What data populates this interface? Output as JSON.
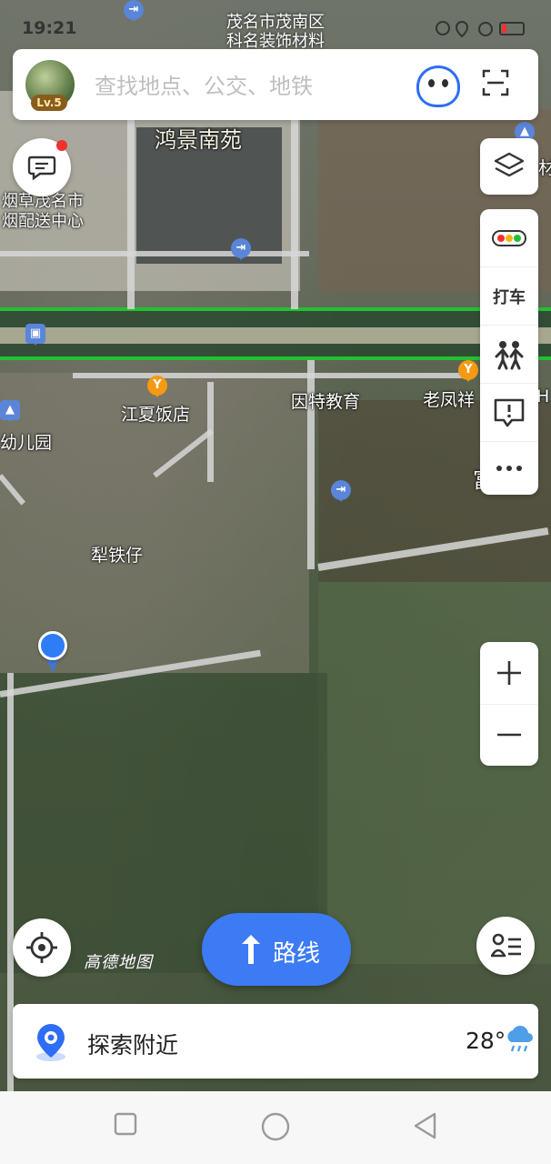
{
  "status_bar": {
    "time": "19:21",
    "top_location_line1": "茂名市茂南区",
    "top_location_line2": "科名装饰材料"
  },
  "search": {
    "level_badge": "Lv.5",
    "placeholder": "查找地点、公交、地铁"
  },
  "map_labels": {
    "hongjing": "鸿景南苑",
    "tobacco_line1": "烟草茂名市",
    "tobacco_line2": "烟配送中心",
    "jiangxia": "江夏饭店",
    "yinte": "因特教育",
    "laofengxiang": "老凤祥",
    "kindergarten": "幼儿园",
    "litiezai": "犁铁仔",
    "fu_partial": "富",
    "h_partial": "H",
    "cai_partial": "材",
    "watermark": "高德地图"
  },
  "side_tools": {
    "taxi_label": "打车"
  },
  "route": {
    "label": "路线"
  },
  "explore": {
    "label": "探索附近",
    "temperature": "28°"
  },
  "colors": {
    "accent_blue": "#3d7bf5",
    "highway_green": "#23c033",
    "poi_orange": "#f59a12",
    "notification_red": "#f2302c"
  }
}
